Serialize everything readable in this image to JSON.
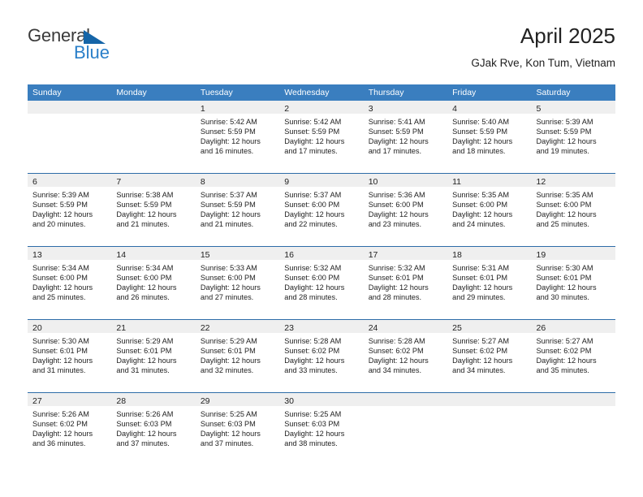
{
  "logo": {
    "word_one": "General",
    "word_two": "Blue",
    "triangle_icon": "triangle-icon",
    "accent_dark": "#3a3a3a",
    "accent_blue": "#2a7fc9",
    "triangle_color": "#1565a8"
  },
  "header": {
    "title": "April 2025",
    "subtitle": "GJak Rve, Kon Tum, Vietnam",
    "header_bg": "#3a7ebf",
    "date_band_bg": "#efefef",
    "week_divider": "#2d6ca8"
  },
  "calendar": {
    "day_headers": [
      "Sunday",
      "Monday",
      "Tuesday",
      "Wednesday",
      "Thursday",
      "Friday",
      "Saturday"
    ],
    "weeks": [
      [
        {
          "date": "",
          "lines": []
        },
        {
          "date": "",
          "lines": []
        },
        {
          "date": "1",
          "lines": [
            "Sunrise: 5:42 AM",
            "Sunset: 5:59 PM",
            "Daylight: 12 hours",
            "and 16 minutes."
          ]
        },
        {
          "date": "2",
          "lines": [
            "Sunrise: 5:42 AM",
            "Sunset: 5:59 PM",
            "Daylight: 12 hours",
            "and 17 minutes."
          ]
        },
        {
          "date": "3",
          "lines": [
            "Sunrise: 5:41 AM",
            "Sunset: 5:59 PM",
            "Daylight: 12 hours",
            "and 17 minutes."
          ]
        },
        {
          "date": "4",
          "lines": [
            "Sunrise: 5:40 AM",
            "Sunset: 5:59 PM",
            "Daylight: 12 hours",
            "and 18 minutes."
          ]
        },
        {
          "date": "5",
          "lines": [
            "Sunrise: 5:39 AM",
            "Sunset: 5:59 PM",
            "Daylight: 12 hours",
            "and 19 minutes."
          ]
        }
      ],
      [
        {
          "date": "6",
          "lines": [
            "Sunrise: 5:39 AM",
            "Sunset: 5:59 PM",
            "Daylight: 12 hours",
            "and 20 minutes."
          ]
        },
        {
          "date": "7",
          "lines": [
            "Sunrise: 5:38 AM",
            "Sunset: 5:59 PM",
            "Daylight: 12 hours",
            "and 21 minutes."
          ]
        },
        {
          "date": "8",
          "lines": [
            "Sunrise: 5:37 AM",
            "Sunset: 5:59 PM",
            "Daylight: 12 hours",
            "and 21 minutes."
          ]
        },
        {
          "date": "9",
          "lines": [
            "Sunrise: 5:37 AM",
            "Sunset: 6:00 PM",
            "Daylight: 12 hours",
            "and 22 minutes."
          ]
        },
        {
          "date": "10",
          "lines": [
            "Sunrise: 5:36 AM",
            "Sunset: 6:00 PM",
            "Daylight: 12 hours",
            "and 23 minutes."
          ]
        },
        {
          "date": "11",
          "lines": [
            "Sunrise: 5:35 AM",
            "Sunset: 6:00 PM",
            "Daylight: 12 hours",
            "and 24 minutes."
          ]
        },
        {
          "date": "12",
          "lines": [
            "Sunrise: 5:35 AM",
            "Sunset: 6:00 PM",
            "Daylight: 12 hours",
            "and 25 minutes."
          ]
        }
      ],
      [
        {
          "date": "13",
          "lines": [
            "Sunrise: 5:34 AM",
            "Sunset: 6:00 PM",
            "Daylight: 12 hours",
            "and 25 minutes."
          ]
        },
        {
          "date": "14",
          "lines": [
            "Sunrise: 5:34 AM",
            "Sunset: 6:00 PM",
            "Daylight: 12 hours",
            "and 26 minutes."
          ]
        },
        {
          "date": "15",
          "lines": [
            "Sunrise: 5:33 AM",
            "Sunset: 6:00 PM",
            "Daylight: 12 hours",
            "and 27 minutes."
          ]
        },
        {
          "date": "16",
          "lines": [
            "Sunrise: 5:32 AM",
            "Sunset: 6:00 PM",
            "Daylight: 12 hours",
            "and 28 minutes."
          ]
        },
        {
          "date": "17",
          "lines": [
            "Sunrise: 5:32 AM",
            "Sunset: 6:01 PM",
            "Daylight: 12 hours",
            "and 28 minutes."
          ]
        },
        {
          "date": "18",
          "lines": [
            "Sunrise: 5:31 AM",
            "Sunset: 6:01 PM",
            "Daylight: 12 hours",
            "and 29 minutes."
          ]
        },
        {
          "date": "19",
          "lines": [
            "Sunrise: 5:30 AM",
            "Sunset: 6:01 PM",
            "Daylight: 12 hours",
            "and 30 minutes."
          ]
        }
      ],
      [
        {
          "date": "20",
          "lines": [
            "Sunrise: 5:30 AM",
            "Sunset: 6:01 PM",
            "Daylight: 12 hours",
            "and 31 minutes."
          ]
        },
        {
          "date": "21",
          "lines": [
            "Sunrise: 5:29 AM",
            "Sunset: 6:01 PM",
            "Daylight: 12 hours",
            "and 31 minutes."
          ]
        },
        {
          "date": "22",
          "lines": [
            "Sunrise: 5:29 AM",
            "Sunset: 6:01 PM",
            "Daylight: 12 hours",
            "and 32 minutes."
          ]
        },
        {
          "date": "23",
          "lines": [
            "Sunrise: 5:28 AM",
            "Sunset: 6:02 PM",
            "Daylight: 12 hours",
            "and 33 minutes."
          ]
        },
        {
          "date": "24",
          "lines": [
            "Sunrise: 5:28 AM",
            "Sunset: 6:02 PM",
            "Daylight: 12 hours",
            "and 34 minutes."
          ]
        },
        {
          "date": "25",
          "lines": [
            "Sunrise: 5:27 AM",
            "Sunset: 6:02 PM",
            "Daylight: 12 hours",
            "and 34 minutes."
          ]
        },
        {
          "date": "26",
          "lines": [
            "Sunrise: 5:27 AM",
            "Sunset: 6:02 PM",
            "Daylight: 12 hours",
            "and 35 minutes."
          ]
        }
      ],
      [
        {
          "date": "27",
          "lines": [
            "Sunrise: 5:26 AM",
            "Sunset: 6:02 PM",
            "Daylight: 12 hours",
            "and 36 minutes."
          ]
        },
        {
          "date": "28",
          "lines": [
            "Sunrise: 5:26 AM",
            "Sunset: 6:03 PM",
            "Daylight: 12 hours",
            "and 37 minutes."
          ]
        },
        {
          "date": "29",
          "lines": [
            "Sunrise: 5:25 AM",
            "Sunset: 6:03 PM",
            "Daylight: 12 hours",
            "and 37 minutes."
          ]
        },
        {
          "date": "30",
          "lines": [
            "Sunrise: 5:25 AM",
            "Sunset: 6:03 PM",
            "Daylight: 12 hours",
            "and 38 minutes."
          ]
        },
        {
          "date": "",
          "lines": []
        },
        {
          "date": "",
          "lines": []
        },
        {
          "date": "",
          "lines": []
        }
      ]
    ]
  }
}
